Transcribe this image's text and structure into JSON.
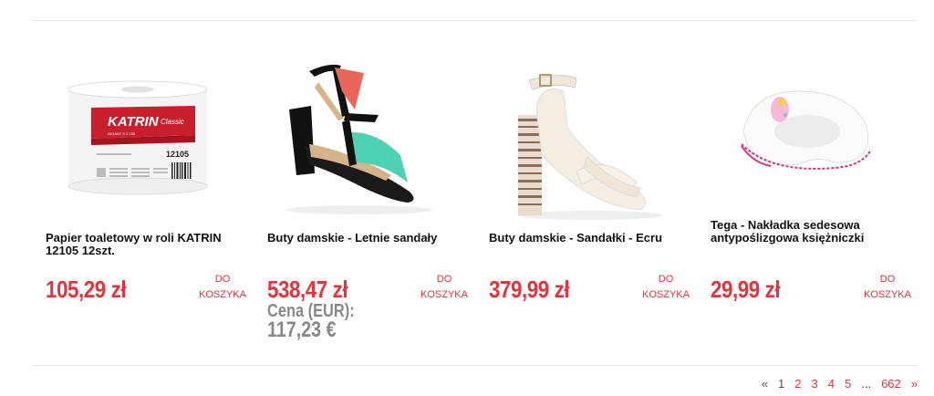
{
  "products": [
    {
      "title": "Papier toaletowy w roli KATRIN 12105 12szt.",
      "price": "105,29 zł",
      "cart_line1": "DO",
      "cart_line2": "KOSZYKA",
      "image": {
        "brand": "KATRIN",
        "sub": "Classic",
        "code": "12105",
        "tagline": "GIGANT S 2 150"
      }
    },
    {
      "title": "Buty damskie - Letnie sandały",
      "price": "538,47 zł",
      "cart_line1": "DO",
      "cart_line2": "KOSZYKA",
      "eur_label": "Cena (EUR):",
      "eur_value": "117,23 €"
    },
    {
      "title": "Buty damskie - Sandałki - Ecru",
      "price": "379,99 zł",
      "cart_line1": "DO",
      "cart_line2": "KOSZYKA"
    },
    {
      "title": "Tega - Nakładka sedesowa antypoślizgowa księżniczki",
      "price": "29,99 zł",
      "cart_line1": "DO",
      "cart_line2": "KOSZYKA"
    }
  ],
  "pagination": {
    "prev": "«",
    "pages": [
      "1",
      "2",
      "3",
      "4",
      "5"
    ],
    "ellipsis": "...",
    "last": "662",
    "next": "»"
  },
  "colors": {
    "accent": "#e5323b",
    "muted": "#888888"
  }
}
